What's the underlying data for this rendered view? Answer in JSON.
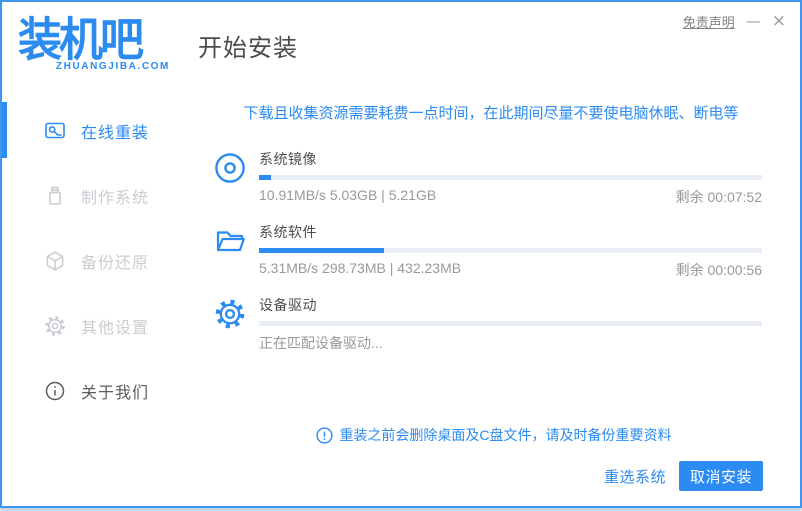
{
  "colors": {
    "accent": "#2b8bf0",
    "border": "#3e96ee",
    "track": "#e9eef5"
  },
  "logo": {
    "title": "装机吧",
    "domain": "ZHUANGJIBA.COM"
  },
  "header": {
    "title": "开始安装"
  },
  "window": {
    "disclaimer": "免责声明",
    "minimize_icon": "—",
    "close_icon": "×"
  },
  "sidebar": {
    "items": [
      {
        "label": "在线重装",
        "icon": "monitor-reinstall-icon",
        "active": true
      },
      {
        "label": "制作系统",
        "icon": "usb-icon",
        "active": false
      },
      {
        "label": "备份还原",
        "icon": "backup-box-icon",
        "active": false
      },
      {
        "label": "其他设置",
        "icon": "gear-icon",
        "active": false
      },
      {
        "label": "关于我们",
        "icon": "info-icon",
        "active": false
      }
    ]
  },
  "main": {
    "notice": "下载且收集资源需要耗费一点时间，在此期间尽量不要使电脑休眠、断电等",
    "tasks": [
      {
        "name": "系统镜像",
        "icon": "disc-icon",
        "percent": 2.4,
        "stats": "10.91MB/s 5.03GB | 5.21GB",
        "remaining": "剩余 00:07:52"
      },
      {
        "name": "系统软件",
        "icon": "folder-icon",
        "percent": 24.8,
        "stats": "5.31MB/s 298.73MB | 432.23MB",
        "remaining": "剩余 00:00:56"
      },
      {
        "name": "设备驱动",
        "icon": "gear-icon",
        "percent": 0,
        "stats": "正在匹配设备驱动...",
        "remaining": ""
      }
    ],
    "warning": "重装之前会删除桌面及C盘文件，请及时备份重要资料"
  },
  "footer": {
    "reselect": "重选系统",
    "cancel": "取消安装"
  }
}
